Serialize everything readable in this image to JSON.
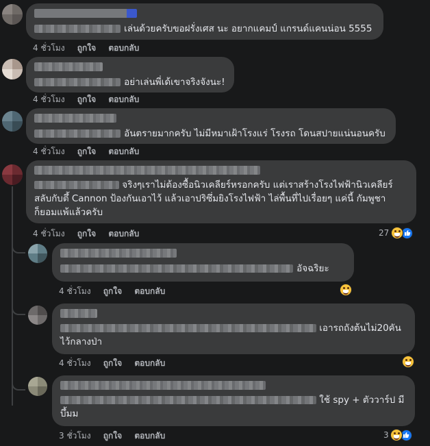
{
  "actions": {
    "like": "ถูกใจ",
    "reply": "ตอบกลับ"
  },
  "comments": [
    {
      "text": "เล่นด้วยครับขอฝรั่งเศส นะ อยากแคมป์ แกรนด์แคนน่อน 5555",
      "time": "4 ชั่วโมง"
    },
    {
      "text": "อย่าเล่นพี่เด้เขาจริงจังนะ!",
      "time": "4 ชั่วโมง"
    },
    {
      "text": "อันตรายมากครับ ไม่มีหมาเฝ้าโรงแร่ โรงรถ โดนสปายแน่นอนครับ",
      "time": "4 ชั่วโมง"
    },
    {
      "text_line1": "จริงๆเราไม่ต้องซื้อนิวเคลียร์หรอกครับ แต่เราสร้างโรงไฟฟ้านิวเคลียร์",
      "text_line2": "สลับกับตึ้ Cannon ป้องกันเอาไว้ แล้วเอาปริซึ่มยิงโรงไฟฟ้า ไล่พื้นที่ไปเรื่อยๆ แค่นี้ กัมพูชา",
      "text_line3": "ก็ยอมแพ้แล้วครับ",
      "time": "4 ชั่วโมง",
      "reaction_count": "27"
    }
  ],
  "replies": [
    {
      "text": "อัจฉริยะ",
      "time": "4 ชั่วโมง"
    },
    {
      "text_line1": "เอารถถังต้นไม่20คัน",
      "text_line2": "ไว้กลางป่า",
      "time": "4 ชั่วโมง"
    },
    {
      "text_line1": "ใช้ spy + ตัววาร์ป มี",
      "text_line2": "บึ้มม",
      "time": "3 ชั่วโมง",
      "reaction_count": "3"
    }
  ],
  "colors": {
    "background": "#18191a",
    "bubble": "#3a3b3c",
    "like_blue": "#1877f2",
    "muted_text": "#b0b3b8"
  }
}
